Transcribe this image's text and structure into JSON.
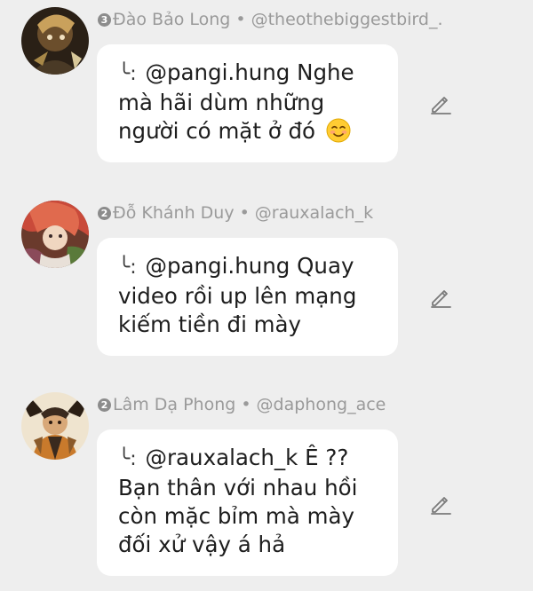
{
  "comments": [
    {
      "rank_badge": "3",
      "author": "Đào Bảo Long",
      "separator": "•",
      "handle": "@theothebiggestbird_.",
      "reply_marker": "╰:",
      "text": "@pangi.hung Nghe mà hãi dùm những người có mặt ở đó",
      "emoji": "smiling-face-emoji"
    },
    {
      "rank_badge": "2",
      "author": "Đỗ Khánh Duy",
      "separator": "•",
      "handle": "@rauxalach_k",
      "reply_marker": "╰:",
      "text": "@pangi.hung Quay video rồi up lên mạng kiếm tiền đi mày"
    },
    {
      "rank_badge": "2",
      "author": "Lâm Dạ Phong",
      "separator": "•",
      "handle": "@daphong_ace",
      "reply_marker": "╰:",
      "text": "@rauxalach_k Ê ?? Bạn thân với nhau hồi còn mặc bỉm mà mày đối xử vậy á hả"
    }
  ],
  "colors": {
    "background": "#eeeeee",
    "bubble": "#ffffff",
    "meta_text": "#9a9a9a",
    "body_text": "#1d1d1d"
  }
}
